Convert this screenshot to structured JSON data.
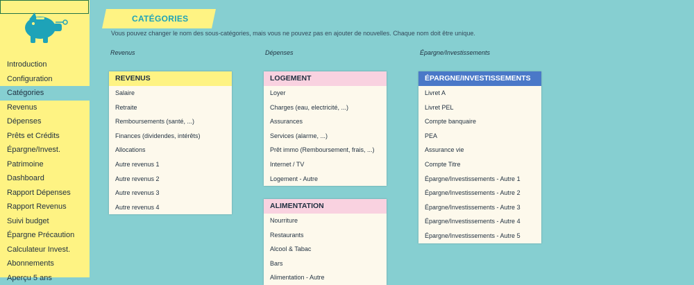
{
  "sidebar": {
    "items": [
      {
        "label": "Introduction",
        "active": false
      },
      {
        "label": "Configuration",
        "active": false
      },
      {
        "label": "Catégories",
        "active": true
      },
      {
        "label": "Revenus",
        "active": false
      },
      {
        "label": "Dépenses",
        "active": false
      },
      {
        "label": "Prêts et Crédits",
        "active": false
      },
      {
        "label": "Épargne/Invest.",
        "active": false
      },
      {
        "label": "Patrimoine",
        "active": false
      },
      {
        "label": "Dashboard",
        "active": false
      },
      {
        "label": "Rapport Dépenses",
        "active": false
      },
      {
        "label": "Rapport Revenus",
        "active": false
      },
      {
        "label": "Suivi budget",
        "active": false
      },
      {
        "label": "Épargne Précaution",
        "active": false
      },
      {
        "label": "Calculateur Invest.",
        "active": false
      },
      {
        "label": "Abonnements",
        "active": false
      },
      {
        "label": "Aperçu 5 ans",
        "active": false
      }
    ]
  },
  "page": {
    "title": "CATÉGORIES",
    "subtitle": "Vous pouvez changer le nom des sous-catégories, mais vous ne pouvez pas en ajouter de nouvelles. Chaque nom doit être unique."
  },
  "columns": [
    {
      "label": "Revenus"
    },
    {
      "label": "Dépenses"
    },
    {
      "label": "Épargne/Investissements"
    }
  ],
  "cards": {
    "revenus": {
      "header": "REVENUS",
      "color": "#fef383",
      "text_color": "#1f2f3f",
      "items": [
        "Salaire",
        "Retraite",
        "Remboursements (santé, ...)",
        "Finances (dividendes, intérêts)",
        "Allocations",
        "Autre revenus 1",
        "Autre revenus 2",
        "Autre revenus 3",
        "Autre revenus 4"
      ]
    },
    "logement": {
      "header": "LOGEMENT",
      "color": "#f9d2e0",
      "text_color": "#1f2f3f",
      "items": [
        "Loyer",
        "Charges (eau, electricité, ...)",
        "Assurances",
        "Services (alarme, ...)",
        "Prêt immo (Remboursement, frais, ...)",
        "Internet / TV",
        "Logement - Autre"
      ]
    },
    "alimentation": {
      "header": "ALIMENTATION",
      "color": "#f9d2e0",
      "text_color": "#1f2f3f",
      "items": [
        "Nourriture",
        "Restaurants",
        "Alcool & Tabac",
        "Bars",
        "Alimentation - Autre"
      ]
    },
    "epargne": {
      "header": "ÉPARGNE/INVESTISSEMENTS",
      "color": "#4a78c8",
      "text_color": "#ffffff",
      "items": [
        "Livret A",
        "Livret PEL",
        "Compte banquaire",
        "PEA",
        "Assurance vie",
        "Compte Titre",
        "Épargne/Investissements - Autre 1",
        "Épargne/Investissements - Autre 2",
        "Épargne/Investissements - Autre 3",
        "Épargne/Investissements - Autre 4",
        "Épargne/Investissements - Autre 5"
      ]
    }
  }
}
